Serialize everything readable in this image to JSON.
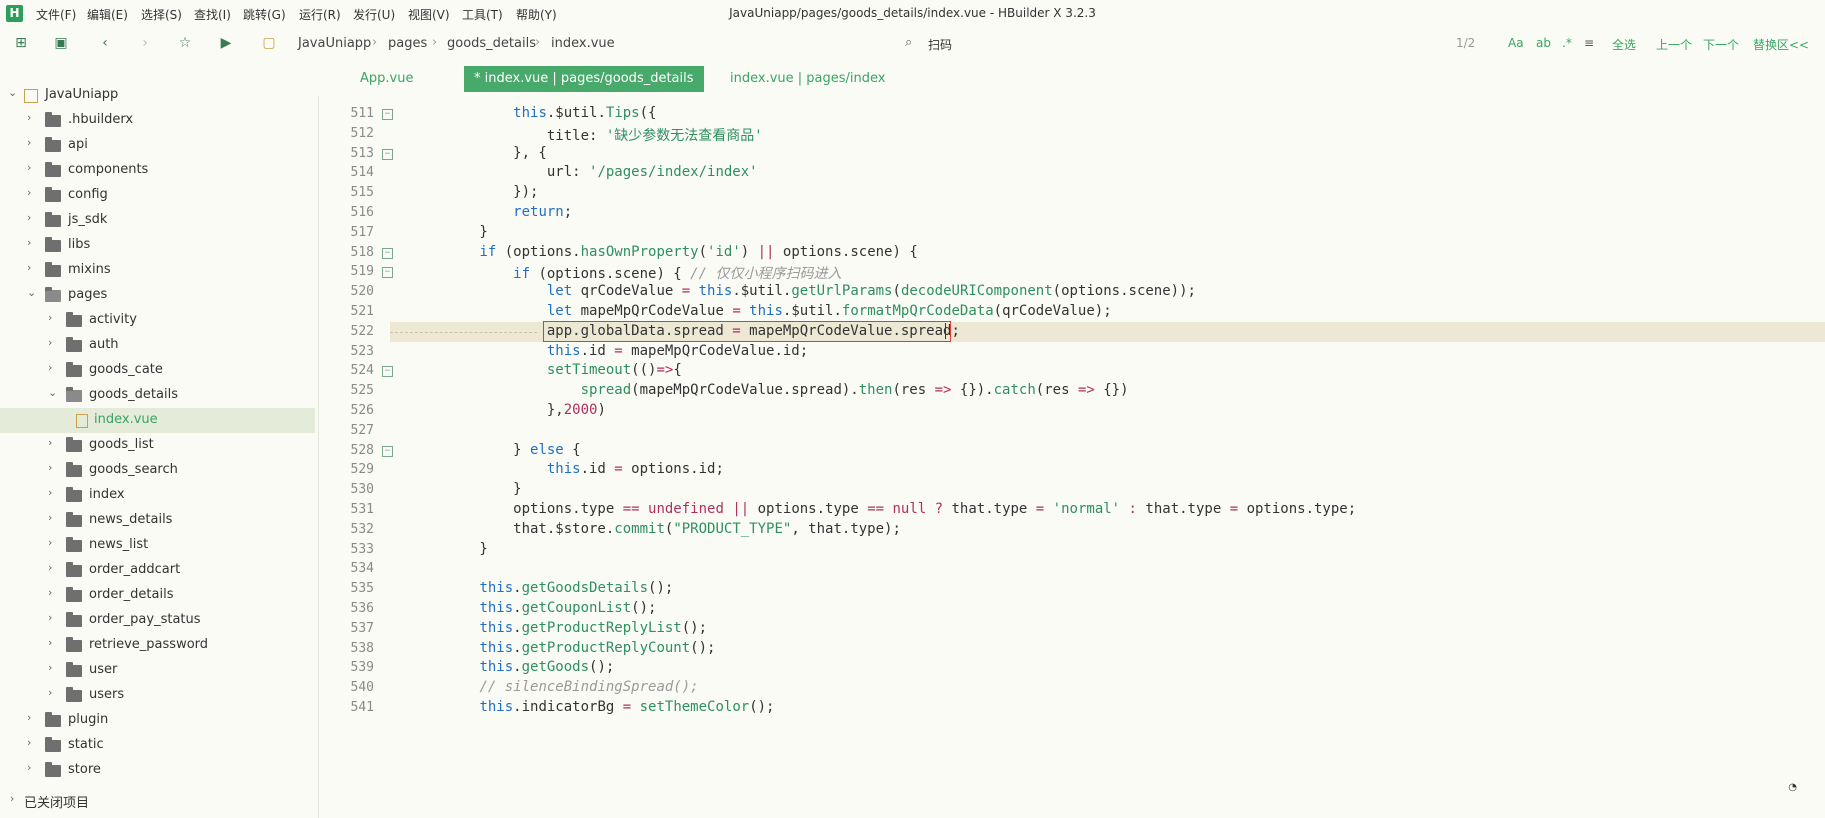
{
  "window": {
    "title": "JavaUniapp/pages/goods_details/index.vue - HBuilder X 3.2.3"
  },
  "menu": [
    "文件(F)",
    "编辑(E)",
    "选择(S)",
    "查找(I)",
    "跳转(G)",
    "运行(R)",
    "发行(U)",
    "视图(V)",
    "工具(T)",
    "帮助(Y)"
  ],
  "breadcrumb": [
    "JavaUniapp",
    "pages",
    "goods_details",
    "index.vue"
  ],
  "search": {
    "label": "扫码",
    "match_count": "1/2"
  },
  "search_actions": [
    "Aa",
    "全选",
    "上一个",
    "下一个",
    "替换区<<"
  ],
  "sidebar": {
    "project": "JavaUniapp",
    "items": [
      {
        "label": ".hbuilderx",
        "depth": 1
      },
      {
        "label": "api",
        "depth": 1
      },
      {
        "label": "components",
        "depth": 1
      },
      {
        "label": "config",
        "depth": 1
      },
      {
        "label": "js_sdk",
        "depth": 1
      },
      {
        "label": "libs",
        "depth": 1
      },
      {
        "label": "mixins",
        "depth": 1
      },
      {
        "label": "pages",
        "depth": 1,
        "open": true
      },
      {
        "label": "activity",
        "depth": 2
      },
      {
        "label": "auth",
        "depth": 2
      },
      {
        "label": "goods_cate",
        "depth": 2
      },
      {
        "label": "goods_details",
        "depth": 2,
        "open": true
      },
      {
        "label": "index.vue",
        "depth": 3,
        "file": true,
        "selected": true
      },
      {
        "label": "goods_list",
        "depth": 2
      },
      {
        "label": "goods_search",
        "depth": 2
      },
      {
        "label": "index",
        "depth": 2
      },
      {
        "label": "news_details",
        "depth": 2
      },
      {
        "label": "news_list",
        "depth": 2
      },
      {
        "label": "order_addcart",
        "depth": 2
      },
      {
        "label": "order_details",
        "depth": 2
      },
      {
        "label": "order_pay_status",
        "depth": 2
      },
      {
        "label": "retrieve_password",
        "depth": 2
      },
      {
        "label": "user",
        "depth": 2
      },
      {
        "label": "users",
        "depth": 2
      },
      {
        "label": "plugin",
        "depth": 1
      },
      {
        "label": "static",
        "depth": 1
      },
      {
        "label": "store",
        "depth": 1
      }
    ],
    "closed_projects": "已关闭项目"
  },
  "tabs": [
    {
      "label": "App.vue",
      "active": false
    },
    {
      "label": "* index.vue | pages/goods_details",
      "active": true
    },
    {
      "label": "index.vue | pages/index",
      "active": false
    }
  ],
  "editor": {
    "highlight_line": 522,
    "lines": [
      {
        "n": 511,
        "fold": true,
        "t": [
          [
            "",
            "            "
          ],
          [
            "kw",
            "this"
          ],
          [
            "",
            ".$util."
          ],
          [
            "fn",
            "Tips"
          ],
          [
            "",
            "({"
          ]
        ]
      },
      {
        "n": 512,
        "t": [
          [
            "",
            "                title: "
          ],
          [
            "str",
            "'缺少参数无法查看商品'"
          ]
        ]
      },
      {
        "n": 513,
        "fold": true,
        "t": [
          [
            "",
            "            }, {"
          ]
        ]
      },
      {
        "n": 514,
        "t": [
          [
            "",
            "                url: "
          ],
          [
            "str",
            "'/pages/index/index'"
          ]
        ]
      },
      {
        "n": 515,
        "t": [
          [
            "",
            "            });"
          ]
        ]
      },
      {
        "n": 516,
        "t": [
          [
            "",
            "            "
          ],
          [
            "kw",
            "return"
          ],
          [
            "",
            ";"
          ]
        ]
      },
      {
        "n": 517,
        "t": [
          [
            "",
            "        }"
          ]
        ]
      },
      {
        "n": 518,
        "fold": true,
        "t": [
          [
            "",
            "        "
          ],
          [
            "kw",
            "if"
          ],
          [
            "",
            " (options."
          ],
          [
            "fn",
            "hasOwnProperty"
          ],
          [
            "",
            "("
          ],
          [
            "str",
            "'id'"
          ],
          [
            "",
            ") "
          ],
          [
            "pu",
            "||"
          ],
          [
            "",
            " options.scene) {"
          ]
        ]
      },
      {
        "n": 519,
        "fold": true,
        "t": [
          [
            "",
            "            "
          ],
          [
            "kw",
            "if"
          ],
          [
            "",
            " (options.scene) { "
          ],
          [
            "cm",
            "// 仅仅小程序扫码进入"
          ]
        ]
      },
      {
        "n": 520,
        "t": [
          [
            "",
            "                "
          ],
          [
            "kw",
            "let"
          ],
          [
            "",
            " qrCodeValue "
          ],
          [
            "pu",
            "="
          ],
          [
            " ",
            ""
          ],
          [
            "kw",
            " this"
          ],
          [
            "",
            ".$util."
          ],
          [
            "fn",
            "getUrlParams"
          ],
          [
            "",
            "("
          ],
          [
            "fn",
            "decodeURIComponent"
          ],
          [
            "",
            "(options.scene));"
          ]
        ]
      },
      {
        "n": 521,
        "t": [
          [
            "",
            "                "
          ],
          [
            "kw",
            "let"
          ],
          [
            "",
            " mapeMpQrCodeValue "
          ],
          [
            "pu",
            "="
          ],
          [
            "kw",
            " this"
          ],
          [
            "",
            ".$util."
          ],
          [
            "fn",
            "formatMpQrCodeData"
          ],
          [
            "",
            "(qrCodeValue);"
          ]
        ]
      },
      {
        "n": 522,
        "t": [
          [
            "",
            "                app.globalData.spread "
          ],
          [
            "pu",
            "="
          ],
          [
            "",
            " mapeMpQrCodeValue.spread;"
          ]
        ]
      },
      {
        "n": 523,
        "t": [
          [
            "",
            "                "
          ],
          [
            "kw",
            "this"
          ],
          [
            "",
            ".id "
          ],
          [
            "pu",
            "="
          ],
          [
            "",
            " mapeMpQrCodeValue.id;"
          ]
        ]
      },
      {
        "n": 524,
        "fold": true,
        "t": [
          [
            "",
            "                "
          ],
          [
            "fn",
            "setTimeout"
          ],
          [
            "",
            "(()"
          ],
          [
            "pu",
            "=>"
          ],
          [
            "",
            "{"
          ]
        ]
      },
      {
        "n": 525,
        "t": [
          [
            "",
            "                    "
          ],
          [
            "fn",
            "spread"
          ],
          [
            "",
            "(mapeMpQrCodeValue.spread)."
          ],
          [
            "fn",
            "then"
          ],
          [
            "",
            "(res "
          ],
          [
            "pu",
            "=>"
          ],
          [
            "",
            " {})."
          ],
          [
            "fn",
            "catch"
          ],
          [
            "",
            "(res "
          ],
          [
            "pu",
            "=>"
          ],
          [
            "",
            " {})"
          ]
        ]
      },
      {
        "n": 526,
        "t": [
          [
            "",
            "                },"
          ],
          [
            "num",
            "2000"
          ],
          [
            "",
            ")"
          ]
        ]
      },
      {
        "n": 527,
        "t": [
          [
            "",
            ""
          ]
        ]
      },
      {
        "n": 528,
        "fold": true,
        "t": [
          [
            "",
            "            } "
          ],
          [
            "kw",
            "else"
          ],
          [
            "",
            " {"
          ]
        ]
      },
      {
        "n": 529,
        "t": [
          [
            "",
            "                "
          ],
          [
            "kw",
            "this"
          ],
          [
            "",
            ".id "
          ],
          [
            "pu",
            "="
          ],
          [
            "",
            " options.id;"
          ]
        ]
      },
      {
        "n": 530,
        "t": [
          [
            "",
            "            }"
          ]
        ]
      },
      {
        "n": 531,
        "t": [
          [
            "",
            "            options.type "
          ],
          [
            "pu",
            "=="
          ],
          [
            "",
            " "
          ],
          [
            "pu",
            "undefined"
          ],
          [
            "",
            " "
          ],
          [
            "pu",
            "||"
          ],
          [
            "",
            " options.type "
          ],
          [
            "pu",
            "=="
          ],
          [
            "",
            " "
          ],
          [
            "pu",
            "null"
          ],
          [
            "",
            " "
          ],
          [
            "pu",
            "?"
          ],
          [
            "",
            " that.type "
          ],
          [
            "pu",
            "="
          ],
          [
            "",
            " "
          ],
          [
            "str",
            "'normal'"
          ],
          [
            "",
            " "
          ],
          [
            "pu",
            ":"
          ],
          [
            "",
            " that.type "
          ],
          [
            "pu",
            "="
          ],
          [
            "",
            " options.type;"
          ]
        ]
      },
      {
        "n": 532,
        "t": [
          [
            "",
            "            that.$store."
          ],
          [
            "fn",
            "commit"
          ],
          [
            "",
            "("
          ],
          [
            "str",
            "\"PRODUCT_TYPE\""
          ],
          [
            "",
            ", that.type);"
          ]
        ]
      },
      {
        "n": 533,
        "t": [
          [
            "",
            "        }"
          ]
        ]
      },
      {
        "n": 534,
        "t": [
          [
            "",
            ""
          ]
        ]
      },
      {
        "n": 535,
        "t": [
          [
            "",
            "        "
          ],
          [
            "kw",
            "this"
          ],
          [
            "",
            "."
          ],
          [
            "fn",
            "getGoodsDetails"
          ],
          [
            "",
            "();"
          ]
        ]
      },
      {
        "n": 536,
        "t": [
          [
            "",
            "        "
          ],
          [
            "kw",
            "this"
          ],
          [
            "",
            "."
          ],
          [
            "fn",
            "getCouponList"
          ],
          [
            "",
            "();"
          ]
        ]
      },
      {
        "n": 537,
        "t": [
          [
            "",
            "        "
          ],
          [
            "kw",
            "this"
          ],
          [
            "",
            "."
          ],
          [
            "fn",
            "getProductReplyList"
          ],
          [
            "",
            "();"
          ]
        ]
      },
      {
        "n": 538,
        "t": [
          [
            "",
            "        "
          ],
          [
            "kw",
            "this"
          ],
          [
            "",
            "."
          ],
          [
            "fn",
            "getProductReplyCount"
          ],
          [
            "",
            "();"
          ]
        ]
      },
      {
        "n": 539,
        "t": [
          [
            "",
            "        "
          ],
          [
            "kw",
            "this"
          ],
          [
            "",
            "."
          ],
          [
            "fn",
            "getGoods"
          ],
          [
            "",
            "();"
          ]
        ]
      },
      {
        "n": 540,
        "t": [
          [
            "",
            "        "
          ],
          [
            "cm",
            "// silenceBindingSpread();"
          ]
        ]
      },
      {
        "n": 541,
        "t": [
          [
            "",
            "        "
          ],
          [
            "kw",
            "this"
          ],
          [
            "",
            ".indicatorBg "
          ],
          [
            "pu",
            "="
          ],
          [
            "",
            " "
          ],
          [
            "fn",
            "setThemeColor"
          ],
          [
            "",
            "();"
          ]
        ]
      }
    ]
  },
  "colors": {
    "accent": "#47aa6b",
    "keyword": "#1f6fc2",
    "string": "#2f8f5f",
    "selection_border": "#e53935"
  }
}
